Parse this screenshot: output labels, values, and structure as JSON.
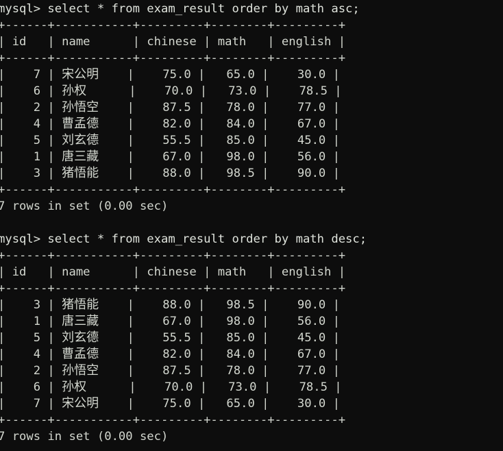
{
  "terminal": {
    "prompt": "mysql>",
    "background_color": "#0d0d0d",
    "text_color": "#d3d7cf",
    "columns": 60,
    "rows": 27
  },
  "blocks": [
    {
      "query": "mysql> select * from exam_result order by math asc;",
      "separator": "+------+-----------+---------+--------+---------+",
      "columns": [
        "id",
        "name",
        "chinese",
        "math",
        "english"
      ],
      "header": "|  id  |  name     | chinese |  math  | english |",
      "rows": [
        {
          "id": "7",
          "name": "宋公明",
          "chinese": "75.0",
          "math": "65.0",
          "english": "30.0"
        },
        {
          "id": "6",
          "name": "孙权",
          "chinese": "70.0",
          "math": "73.0",
          "english": "78.5"
        },
        {
          "id": "2",
          "name": "孙悟空",
          "chinese": "87.5",
          "math": "78.0",
          "english": "77.0"
        },
        {
          "id": "4",
          "name": "曹孟德",
          "chinese": "82.0",
          "math": "84.0",
          "english": "67.0"
        },
        {
          "id": "5",
          "name": "刘玄德",
          "chinese": "55.5",
          "math": "85.0",
          "english": "45.0"
        },
        {
          "id": "1",
          "name": "唐三藏",
          "chinese": "67.0",
          "math": "98.0",
          "english": "56.0"
        },
        {
          "id": "3",
          "name": "猪悟能",
          "chinese": "88.0",
          "math": "98.5",
          "english": "90.0"
        }
      ],
      "status": "7 rows in set (0.00 sec)"
    },
    {
      "query": "mysql> select * from exam_result order by math desc;",
      "separator": "+------+-----------+---------+--------+---------+",
      "columns": [
        "id",
        "name",
        "chinese",
        "math",
        "english"
      ],
      "header": "|  id  |  name     | chinese |  math  | english |",
      "rows": [
        {
          "id": "3",
          "name": "猪悟能",
          "chinese": "88.0",
          "math": "98.5",
          "english": "90.0"
        },
        {
          "id": "1",
          "name": "唐三藏",
          "chinese": "67.0",
          "math": "98.0",
          "english": "56.0"
        },
        {
          "id": "5",
          "name": "刘玄德",
          "chinese": "55.5",
          "math": "85.0",
          "english": "45.0"
        },
        {
          "id": "4",
          "name": "曹孟德",
          "chinese": "82.0",
          "math": "84.0",
          "english": "67.0"
        },
        {
          "id": "2",
          "name": "孙悟空",
          "chinese": "87.5",
          "math": "78.0",
          "english": "77.0"
        },
        {
          "id": "6",
          "name": "孙权",
          "chinese": "70.0",
          "math": "73.0",
          "english": "78.5"
        },
        {
          "id": "7",
          "name": "宋公明",
          "chinese": "75.0",
          "math": "65.0",
          "english": "30.0"
        }
      ],
      "status": "7 rows in set (0.00 sec)"
    }
  ]
}
